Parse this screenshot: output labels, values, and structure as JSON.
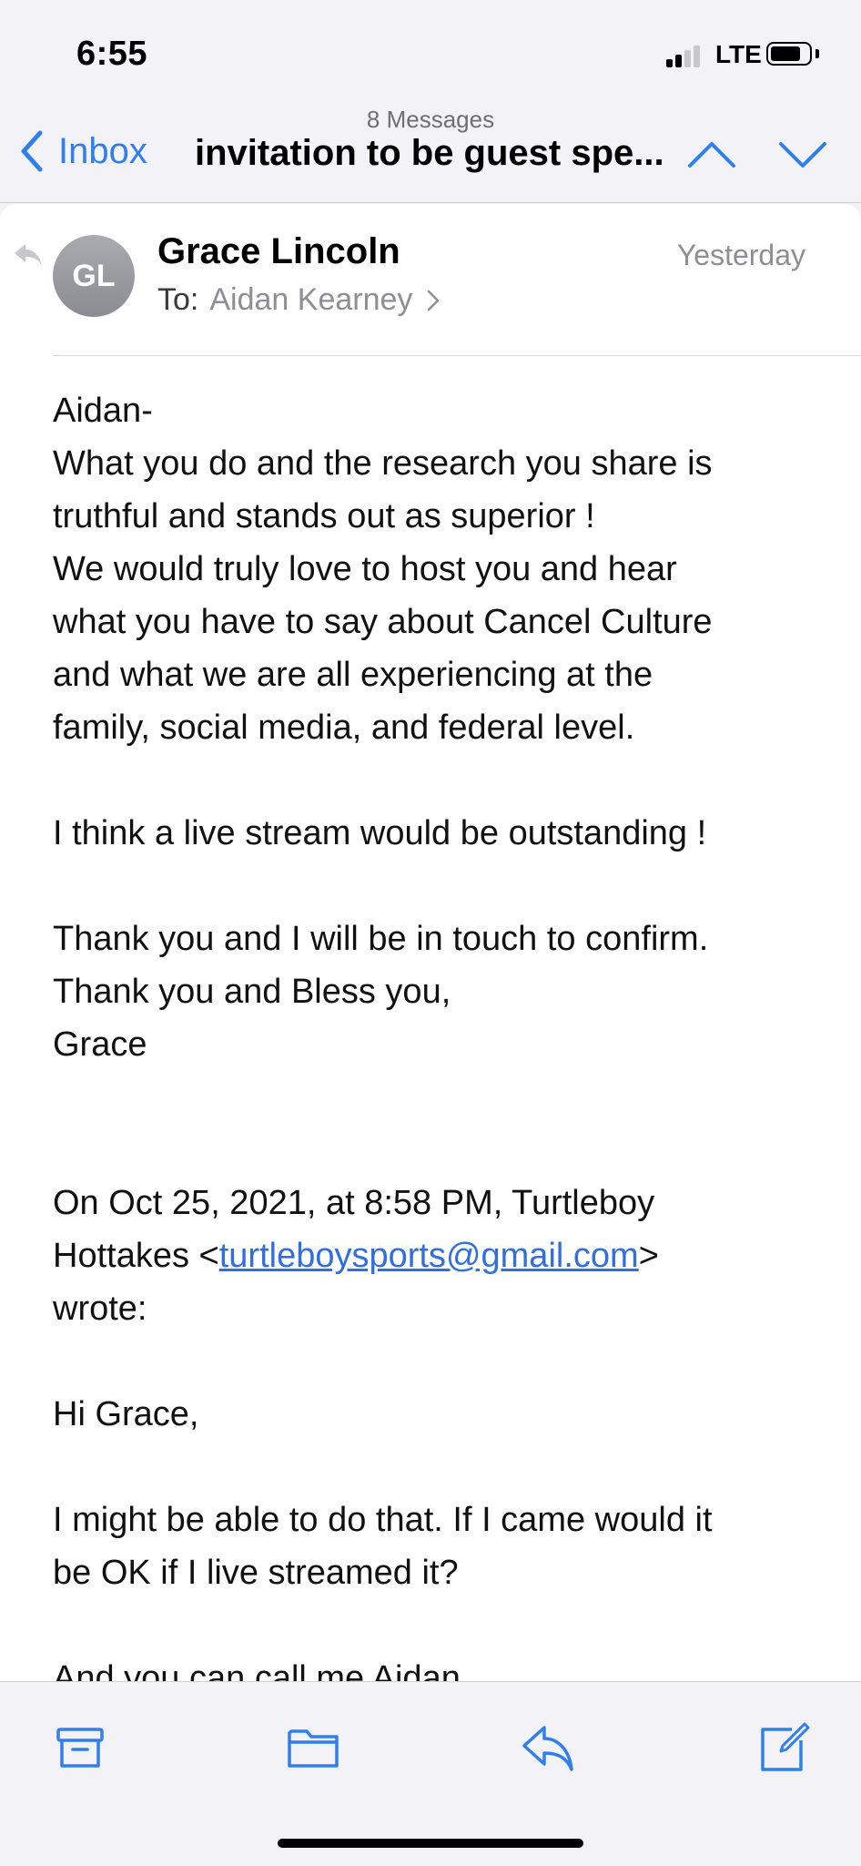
{
  "status_bar": {
    "time": "6:55",
    "network": "LTE"
  },
  "nav": {
    "back_label": "Inbox",
    "message_count": "8 Messages",
    "subject": "invitation to be guest spe..."
  },
  "message": {
    "avatar_initials": "GL",
    "sender": "Grace Lincoln",
    "date": "Yesterday",
    "to_label": "To:",
    "recipient": "Aidan Kearney",
    "body": {
      "p1": "Aidan-\nWhat you do and the research you share is\ntruthful and stands out as superior !\nWe would truly love to host you and hear\nwhat you have to say about Cancel Culture\nand what we are all experiencing at the\nfamily, social media, and federal level.",
      "p2": "I think a live stream would be outstanding !",
      "p3": "Thank you and I will be in touch to confirm.\nThank you and Bless you,\nGrace",
      "quote_intro_1": "On Oct 25, 2021, at 8:58 PM, Turtleboy\nHottakes <",
      "quote_email": "turtleboysports@gmail.com",
      "quote_intro_2": ">\nwrote:",
      "q1": "Hi Grace,",
      "q2": "I might be able to do that. If I came would it\nbe OK if I live streamed it?",
      "q3": "And you can call me Aidan"
    }
  },
  "colors": {
    "accent": "#2f80ed",
    "link": "#2f6fdf",
    "secondary_text": "#8e8e93"
  },
  "toolbar": {
    "icons": [
      "archive-icon",
      "folder-icon",
      "reply-icon",
      "compose-icon"
    ]
  }
}
